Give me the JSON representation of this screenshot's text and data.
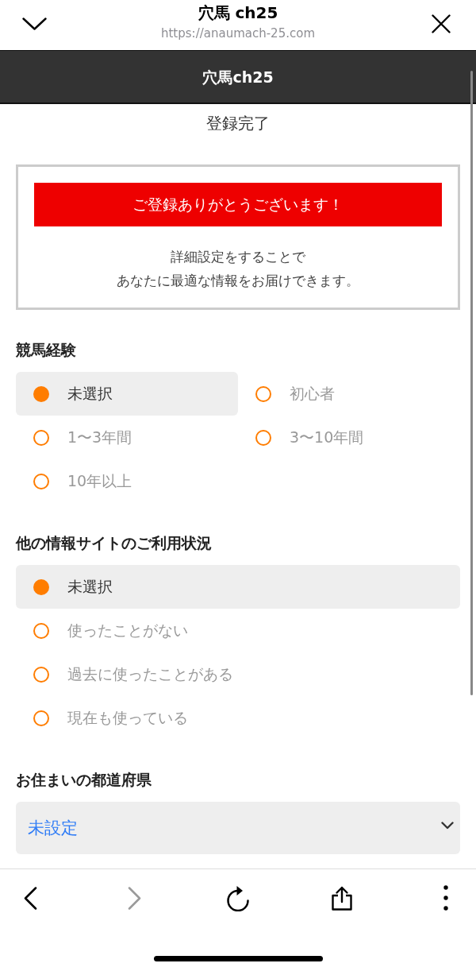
{
  "browser_bar": {
    "title": "穴馬 ch25",
    "url": "https://anaumach-25.com"
  },
  "site_header": {
    "title": "穴馬ch25"
  },
  "page_title": "登録完了",
  "notice": {
    "banner": "ご登録ありがとうございます！",
    "message_lines": [
      "詳細設定をすることで",
      "あなたに最適な情報をお届けできます。"
    ]
  },
  "sections": [
    {
      "kind": "radio-grid",
      "title": "競馬経験",
      "options": [
        {
          "label": "未選択",
          "selected": true
        },
        {
          "label": "初心者",
          "selected": false
        },
        {
          "label": "1〜3年間",
          "selected": false
        },
        {
          "label": "3〜10年間",
          "selected": false
        },
        {
          "label": "10年以上",
          "selected": false
        }
      ]
    },
    {
      "kind": "radio-list",
      "title": "他の情報サイトのご利用状況",
      "options": [
        {
          "label": "未選択",
          "selected": true
        },
        {
          "label": "使ったことがない",
          "selected": false
        },
        {
          "label": "過去に使ったことがある",
          "selected": false
        },
        {
          "label": "現在も使っている",
          "selected": false
        }
      ]
    },
    {
      "kind": "select",
      "title": "お住まいの都道府県",
      "value": "未設定"
    }
  ],
  "toolbar": {
    "back": {
      "disabled": false
    },
    "forward": {
      "disabled": true
    }
  }
}
